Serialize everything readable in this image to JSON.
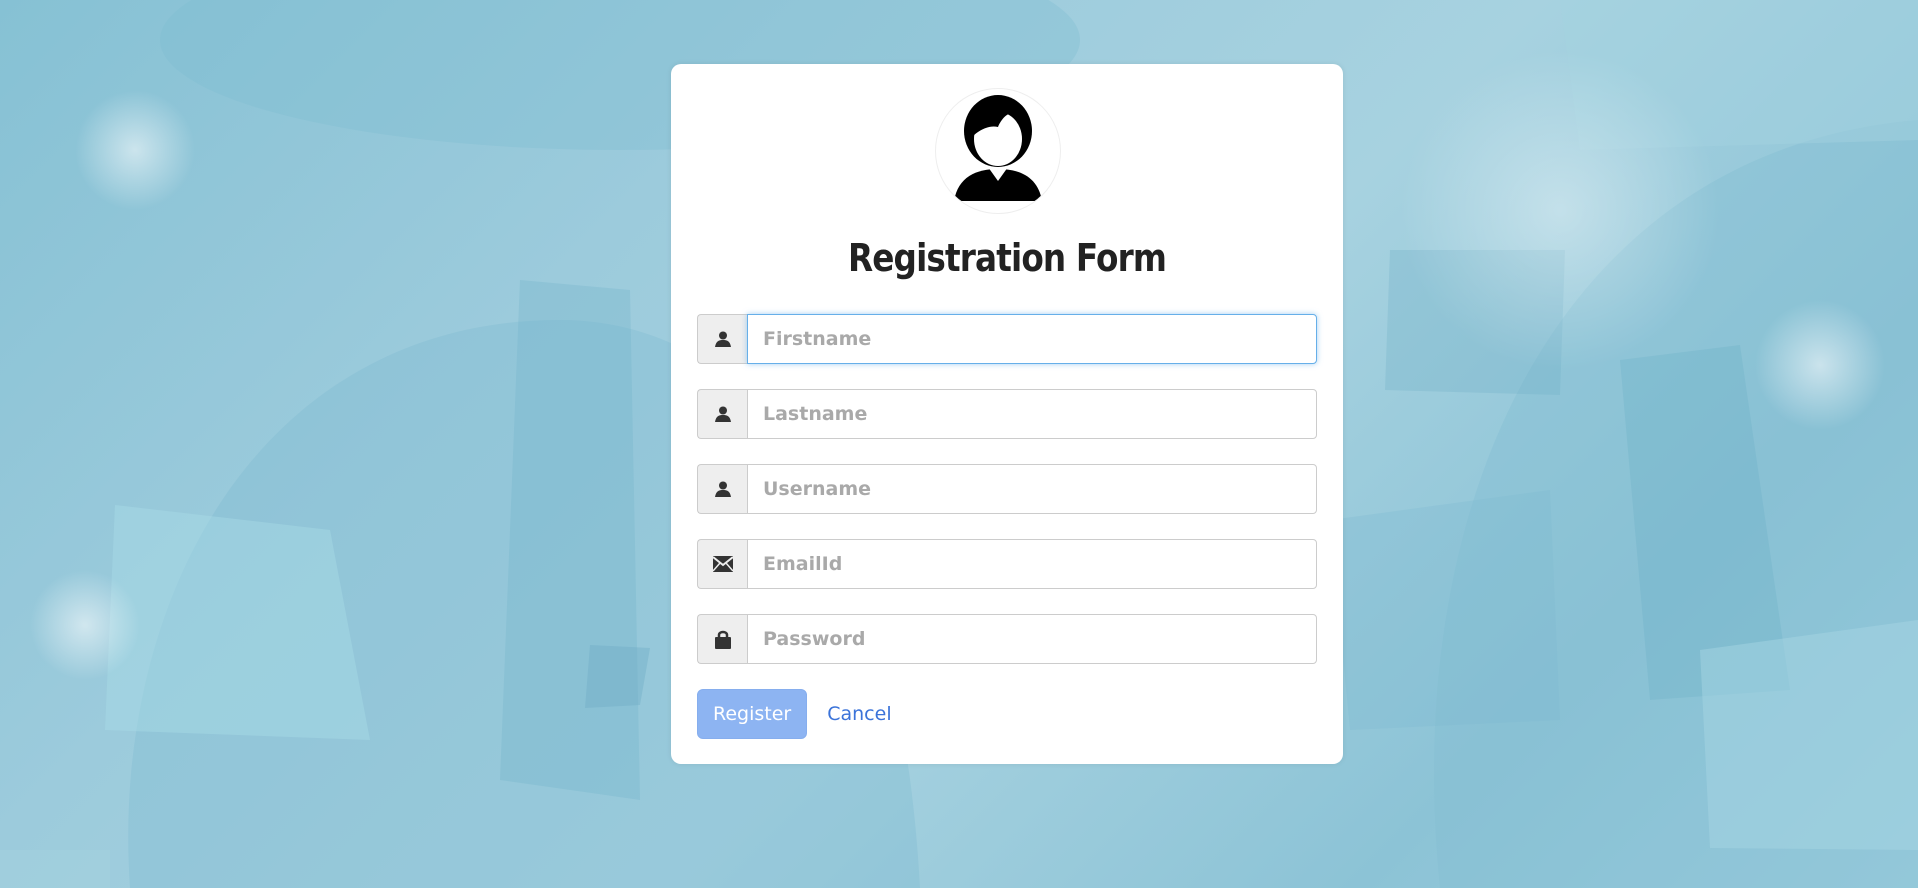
{
  "form": {
    "title": "Registration Form",
    "fields": [
      {
        "name": "firstname",
        "placeholder": "Firstname",
        "value": "",
        "icon": "user-icon",
        "type": "text",
        "focused": true
      },
      {
        "name": "lastname",
        "placeholder": "Lastname",
        "value": "",
        "icon": "user-icon",
        "type": "text"
      },
      {
        "name": "username",
        "placeholder": "Username",
        "value": "",
        "icon": "user-icon",
        "type": "text"
      },
      {
        "name": "emailid",
        "placeholder": "EmailId",
        "value": "",
        "icon": "envelope-icon",
        "type": "email"
      },
      {
        "name": "password",
        "placeholder": "Password",
        "value": "",
        "icon": "lock-icon",
        "type": "password"
      }
    ],
    "register_label": "Register",
    "cancel_label": "Cancel"
  },
  "colors": {
    "register_button": "#8db4f2",
    "cancel_link": "#3b73d9",
    "focus_border": "#66afe9",
    "title": "#222222"
  }
}
